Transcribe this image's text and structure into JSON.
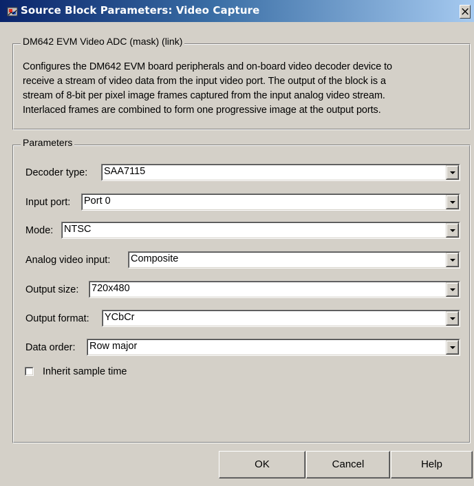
{
  "window": {
    "title": "Source Block Parameters: Video Capture",
    "close_glyph": "×",
    "title_gradient": [
      "#0a246a",
      "#a6caf0"
    ]
  },
  "description": {
    "legend": "DM642 EVM Video ADC (mask) (link)",
    "lines": [
      "Configures the DM642 EVM board peripherals and on-board video decoder device to",
      "receive a stream of video data from the input video port. The output of the block is a",
      "stream of 8-bit per pixel  image frames captured from the input analog video stream.",
      "Interlaced frames are combined to form one progressive image at the output ports."
    ]
  },
  "parameters": {
    "legend": "Parameters",
    "fields": [
      {
        "label": "Decoder type:",
        "value": "SAA7115"
      },
      {
        "label": "Input port:",
        "value": "Port 0"
      },
      {
        "label": "Mode:",
        "value": "NTSC"
      },
      {
        "label": "Analog video input:",
        "value": "Composite"
      },
      {
        "label": "Output size:",
        "value": "720x480"
      },
      {
        "label": "Output format:",
        "value": "YCbCr"
      },
      {
        "label": "Data order:",
        "value": "Row major"
      }
    ],
    "inherit_sample_time": {
      "label": "Inherit sample time",
      "checked": false
    }
  },
  "buttons": {
    "ok": "OK",
    "cancel": "Cancel",
    "help": "Help"
  }
}
